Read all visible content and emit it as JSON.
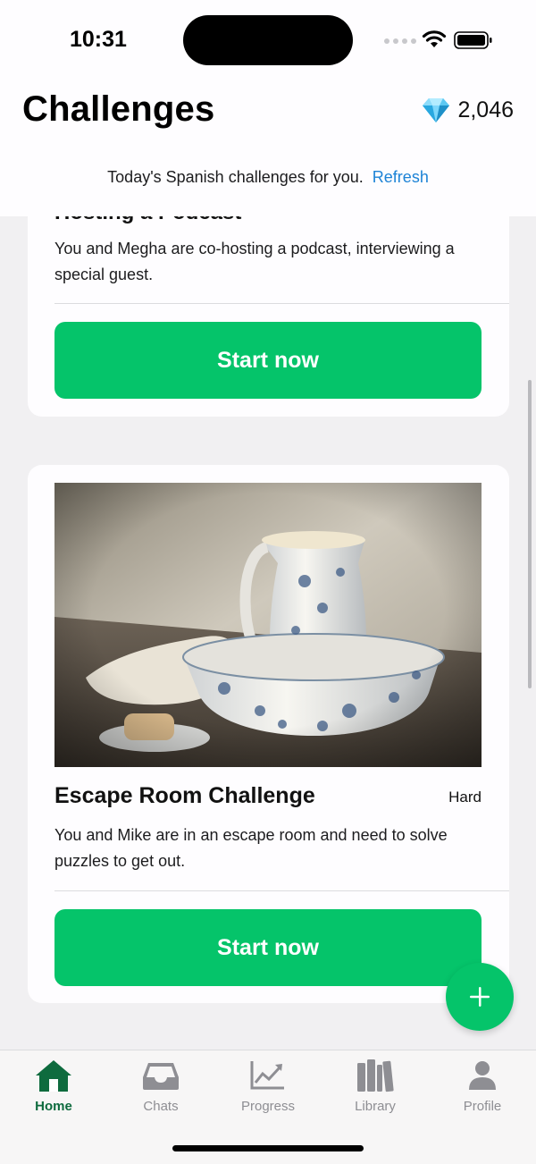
{
  "status_bar": {
    "time": "10:31"
  },
  "header": {
    "title": "Challenges",
    "gem_count": "2,046",
    "subtitle": "Today's Spanish challenges for you.",
    "refresh_label": "Refresh"
  },
  "challenges": [
    {
      "title": "Hosting a Podcast",
      "description": "You and Megha are co-hosting a podcast, interviewing a special guest.",
      "button_label": "Start now"
    },
    {
      "title": "Escape Room Challenge",
      "difficulty": "Hard",
      "description": "You and Mike are in an escape room and need to solve puzzles to get out.",
      "button_label": "Start now"
    }
  ],
  "tabs": [
    {
      "label": "Home",
      "icon": "home-icon",
      "active": true
    },
    {
      "label": "Chats",
      "icon": "inbox-icon",
      "active": false
    },
    {
      "label": "Progress",
      "icon": "chart-icon",
      "active": false
    },
    {
      "label": "Library",
      "icon": "books-icon",
      "active": false
    },
    {
      "label": "Profile",
      "icon": "person-icon",
      "active": false
    }
  ],
  "colors": {
    "accent_green": "#05c46a",
    "active_tab": "#0e6b3e",
    "link_blue": "#1d83d6"
  }
}
